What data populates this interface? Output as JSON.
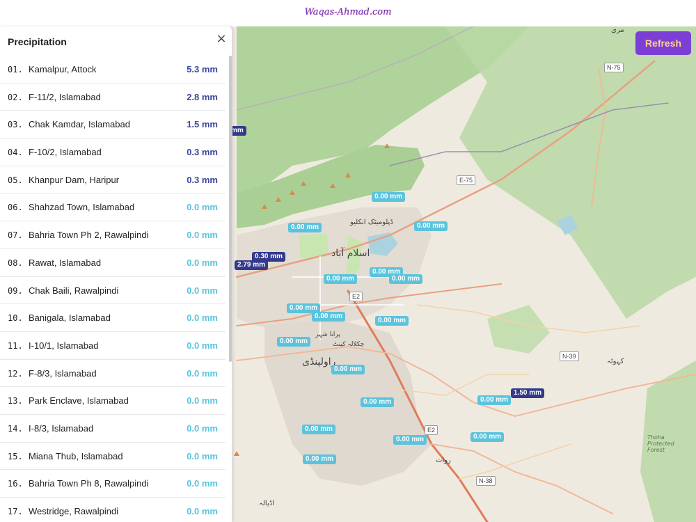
{
  "site": {
    "title": "Waqas-Ahmad.com"
  },
  "toolbar": {
    "refresh_label": "Refresh"
  },
  "panel": {
    "title": "Precipitation",
    "close_glyph": "×",
    "stations": [
      {
        "rank": "01.",
        "name": "Kamalpur, Attock",
        "amount": "5.3 mm",
        "level": "dark"
      },
      {
        "rank": "02.",
        "name": "F-11/2, Islamabad",
        "amount": "2.8 mm",
        "level": "dark"
      },
      {
        "rank": "03.",
        "name": "Chak Kamdar, Islamabad",
        "amount": "1.5 mm",
        "level": "dark"
      },
      {
        "rank": "04.",
        "name": "F-10/2, Islamabad",
        "amount": "0.3 mm",
        "level": "dark"
      },
      {
        "rank": "05.",
        "name": "Khanpur Dam, Haripur",
        "amount": "0.3 mm",
        "level": "dark"
      },
      {
        "rank": "06.",
        "name": "Shahzad Town, Islamabad",
        "amount": "0.0 mm",
        "level": "light"
      },
      {
        "rank": "07.",
        "name": "Bahria Town Ph 2, Rawalpindi",
        "amount": "0.0 mm",
        "level": "light"
      },
      {
        "rank": "08.",
        "name": "Rawat, Islamabad",
        "amount": "0.0 mm",
        "level": "light"
      },
      {
        "rank": "09.",
        "name": "Chak Baili, Rawalpindi",
        "amount": "0.0 mm",
        "level": "light"
      },
      {
        "rank": "10.",
        "name": "Banigala, Islamabad",
        "amount": "0.0 mm",
        "level": "light"
      },
      {
        "rank": "11.",
        "name": "I-10/1, Islamabad",
        "amount": "0.0 mm",
        "level": "light"
      },
      {
        "rank": "12.",
        "name": "F-8/3, Islamabad",
        "amount": "0.0 mm",
        "level": "light"
      },
      {
        "rank": "13.",
        "name": "Park Enclave, Islamabad",
        "amount": "0.0 mm",
        "level": "light"
      },
      {
        "rank": "14.",
        "name": "I-8/3, Islamabad",
        "amount": "0.0 mm",
        "level": "light"
      },
      {
        "rank": "15.",
        "name": "Miana Thub, Islamabad",
        "amount": "0.0 mm",
        "level": "light"
      },
      {
        "rank": "16.",
        "name": "Bahria Town Ph 8, Rawalpindi",
        "amount": "0.0 mm",
        "level": "light"
      },
      {
        "rank": "17.",
        "name": "Westridge, Rawalpindi",
        "amount": "0.0 mm",
        "level": "light"
      }
    ]
  },
  "map": {
    "markers": [
      {
        "label": "0.00 mm",
        "level": "light"
      },
      {
        "label": "0.00 mm",
        "level": "light"
      },
      {
        "label": "0.00 mm",
        "level": "light"
      },
      {
        "label": "0.30 mm",
        "level": "dark"
      },
      {
        "label": "2.79 mm",
        "level": "dark"
      },
      {
        "label": "0.00 mm",
        "level": "light"
      },
      {
        "label": "0.00 mm",
        "level": "light"
      },
      {
        "label": "0.00 mm",
        "level": "light"
      },
      {
        "label": "0.00 mm",
        "level": "light"
      },
      {
        "label": "0.00 mm",
        "level": "light"
      },
      {
        "label": "0.00 mm",
        "level": "light"
      },
      {
        "label": "0.00 mm",
        "level": "light"
      },
      {
        "label": "0.00 mm",
        "level": "light"
      },
      {
        "label": "0.00 mm",
        "level": "light"
      },
      {
        "label": "1.50 mm",
        "level": "dark"
      },
      {
        "label": "0.00 mm",
        "level": "light"
      },
      {
        "label": "0.00 mm",
        "level": "light"
      },
      {
        "label": "0.00 mm",
        "level": "light"
      },
      {
        "label": "0.00 mm",
        "level": "light"
      },
      {
        "label": "0.00 mm",
        "level": "light"
      },
      {
        "label": "mm",
        "level": "dark"
      }
    ],
    "road_shields": [
      "N-75",
      "E-75",
      "E2",
      "E2",
      "N-39",
      "N-38"
    ],
    "place_labels": {
      "islamabad_urdu": "اسلام آباد",
      "rawalpindi_urdu": "راولپنڈی",
      "thoha_forest": "Thoha Protected Forest",
      "kahuta_urdu": "کہوٹہ",
      "rawat_urdu": "روات",
      "adyala_urdu": "اڈیالہ",
      "diplomatic_urdu": "ڈپلومیٹک انکلیو",
      "purana_shehar": "پرانا شہر",
      "chaklala": "چکلالہ کینٹ",
      "murree_urdu": "مری"
    },
    "colors": {
      "dark_marker": "#333a8c",
      "light_marker": "#5bc3dc",
      "refresh_bg": "#7c3fd6",
      "forest": "#a9cf94"
    }
  }
}
